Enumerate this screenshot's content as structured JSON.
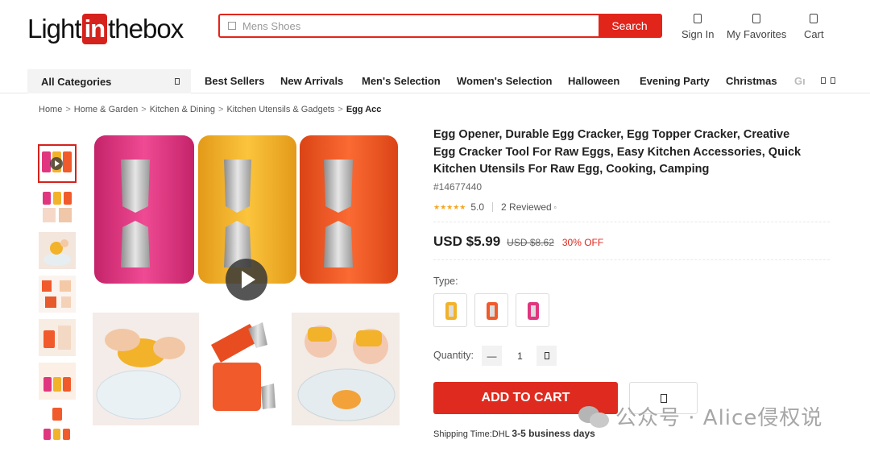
{
  "header": {
    "logo": {
      "part1": "Light",
      "part2": "in",
      "part3": "thebox"
    },
    "search": {
      "placeholder": "Mens Shoes",
      "button": "Search"
    },
    "actions": [
      {
        "label": "Sign In",
        "icon": "user-icon"
      },
      {
        "label": "My Favorites",
        "icon": "heart-icon"
      },
      {
        "label": "Cart",
        "icon": "cart-icon"
      }
    ]
  },
  "nav": {
    "all_categories": "All Categories",
    "items": [
      "Best Sellers",
      "New Arrivals",
      "Men's Selection",
      "Women's Selection",
      "Halloween",
      "Evening Party",
      "Christmas"
    ],
    "overflow_text": "Gı"
  },
  "breadcrumb": [
    "Home",
    "Home & Garden",
    "Kitchen & Dining",
    "Kitchen Utensils & Gadgets",
    "Egg Acc"
  ],
  "breadcrumb_sep": ">",
  "product": {
    "title": "Egg Opener, Durable Egg Cracker, Egg Topper Cracker, Creative Egg Cracker Tool For Raw Eggs, Easy Kitchen Accessories, Quick Kitchen Utensils For Raw Egg, Cooking, Camping",
    "sku": "#14677440",
    "rating": {
      "score": "5.0",
      "reviews": "2 Reviewed",
      "stars": 5
    },
    "price": {
      "current": "USD $5.99",
      "original": "USD $8.62",
      "discount": "30% OFF"
    },
    "type_label": "Type:",
    "types": [
      {
        "name": "yellow",
        "color": "#f2b22a"
      },
      {
        "name": "orange",
        "color": "#f15a2b"
      },
      {
        "name": "pink",
        "color": "#e0367f"
      }
    ],
    "quantity_label": "Quantity:",
    "quantity": "1",
    "add_to_cart": "ADD TO CART",
    "shipping": {
      "label": "Shipping Time:DHL",
      "value": "3-5 business days"
    }
  },
  "colors": {
    "brand_red": "#e1251b",
    "pink": "#e0367f",
    "yellow": "#f2b22a",
    "orange": "#f15a2b"
  },
  "watermark": "公众号 · Alice侵权说"
}
